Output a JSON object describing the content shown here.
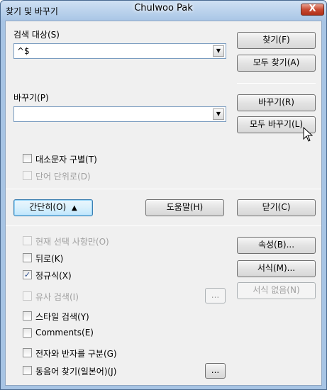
{
  "window": {
    "title": "찾기 및 바꾸기",
    "app_title": "Chulwoo Pak",
    "close_glyph": "X"
  },
  "search": {
    "label": "검색 대상(S)",
    "value": "^$"
  },
  "replace": {
    "label": "바꾸기(P)",
    "value": ""
  },
  "buttons": {
    "find": "찾기(F)",
    "find_all": "모두 찾기(A)",
    "replace": "바꾸기(R)",
    "replace_all": "모두 바꾸기(L)",
    "fewer_options": "간단히(O)",
    "help": "도움말(H)",
    "close": "닫기(C)",
    "attributes": "속성(B)...",
    "format": "서식(M)...",
    "no_format": "서식 없음(N)",
    "similarity_settings": "...",
    "sounds_like_settings": "..."
  },
  "options": {
    "match_case": {
      "label": "대소문자 구별(T)",
      "checked": false,
      "enabled": true
    },
    "whole_words": {
      "label": "단어 단위로(D)",
      "checked": false,
      "enabled": false
    },
    "current_selection": {
      "label": "현재 선택 사항만(O)",
      "checked": false,
      "enabled": false
    },
    "backwards": {
      "label": "뒤로(K)",
      "checked": false,
      "enabled": true
    },
    "regex": {
      "label": "정규식(X)",
      "checked": true,
      "enabled": true
    },
    "similarity": {
      "label": "유사 검색(I)",
      "checked": false,
      "enabled": false
    },
    "styles": {
      "label": "스타일 검색(Y)",
      "checked": false,
      "enabled": true
    },
    "comments": {
      "label": "Comments(E)",
      "checked": false,
      "enabled": true
    },
    "width_match": {
      "label": "전자와 반자를 구분(G)",
      "checked": false,
      "enabled": true
    },
    "sounds_like": {
      "label": "동음어 찾기(일본어)(J)",
      "checked": false,
      "enabled": true
    }
  },
  "glyphs": {
    "dropdown_arrow": "▼",
    "collapse_arrow": "▲",
    "check": "✓"
  },
  "colors": {
    "titlebar": "#a9c6e6",
    "close": "#c84a32",
    "client": "#f0f0f0"
  }
}
